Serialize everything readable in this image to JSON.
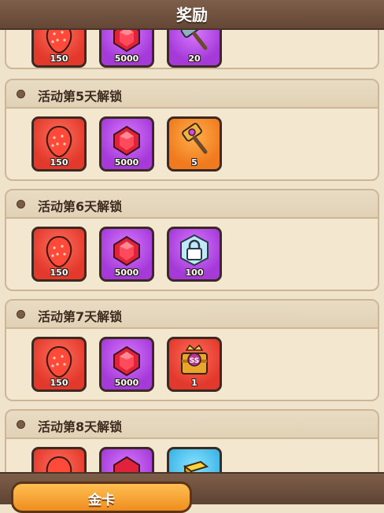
{
  "header": {
    "title": "奖励"
  },
  "partial_section": {
    "items": [
      {
        "icon": "strawberry-icon",
        "count": "150",
        "bg": "red"
      },
      {
        "icon": "ruby-gem-icon",
        "count": "5000",
        "bg": "purple"
      },
      {
        "icon": "hammer-icon",
        "count": "20",
        "bg": "purple"
      }
    ]
  },
  "sections": [
    {
      "title": "活动第5天解锁",
      "items": [
        {
          "icon": "strawberry-icon",
          "count": "150",
          "bg": "red"
        },
        {
          "icon": "ruby-gem-icon",
          "count": "5000",
          "bg": "purple"
        },
        {
          "icon": "hammer-icon",
          "count": "5",
          "bg": "orange"
        }
      ]
    },
    {
      "title": "活动第6天解锁",
      "items": [
        {
          "icon": "strawberry-icon",
          "count": "150",
          "bg": "red"
        },
        {
          "icon": "ruby-gem-icon",
          "count": "5000",
          "bg": "purple"
        },
        {
          "icon": "lock-icon",
          "count": "100",
          "bg": "purple"
        }
      ]
    },
    {
      "title": "活动第7天解锁",
      "items": [
        {
          "icon": "strawberry-icon",
          "count": "150",
          "bg": "red"
        },
        {
          "icon": "ruby-gem-icon",
          "count": "5000",
          "bg": "purple"
        },
        {
          "icon": "ss-treasure-chest-icon",
          "count": "1",
          "bg": "red"
        }
      ]
    },
    {
      "title": "活动第8天解锁",
      "items": [
        {
          "icon": "strawberry-icon",
          "count": "",
          "bg": "red"
        },
        {
          "icon": "ruby-gem-icon",
          "count": "",
          "bg": "purple"
        },
        {
          "icon": "gold-bars-icon",
          "count": "",
          "bg": "blue"
        }
      ]
    }
  ],
  "footer": {
    "gold_card_label": "金卡"
  },
  "colors": {
    "header_bg": "#6f5140",
    "panel_bg": "#f3e7cf",
    "item_red": "#e3392d",
    "item_purple": "#a53ad9",
    "item_orange": "#f07b1e",
    "item_blue": "#3ab4e6",
    "button_gold": "#f8a53a"
  }
}
